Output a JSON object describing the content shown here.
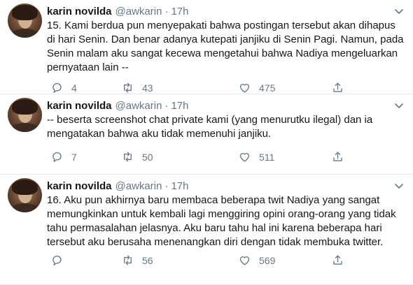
{
  "tweets": [
    {
      "name": "karin novilda",
      "handle": "@awkarin",
      "dot": "·",
      "time": "17h",
      "lines": [
        "15. Kami berdua pun menyepakati bahwa postingan tersebut akan dihapus",
        "di hari Senin. Dan benar adanya kutepati janjiku di Senin Pagi. Namun, pada",
        "Senin malam aku sangat kecewa mengetahui bahwa Nadiya mengeluarkan",
        "pernyataan lain --"
      ],
      "replies": "4",
      "retweets": "43",
      "likes": "475"
    },
    {
      "name": "karin novilda",
      "handle": "@awkarin",
      "dot": "·",
      "time": "17h",
      "lines": [
        "-- beserta screenshot chat private kami (yang menurutku ilegal) dan ia",
        "mengatakan bahwa aku tidak memenuhi janjiku."
      ],
      "replies": "7",
      "retweets": "50",
      "likes": "511"
    },
    {
      "name": "karin novilda",
      "handle": "@awkarin",
      "dot": "·",
      "time": "17h",
      "lines": [
        "16. Aku pun akhirnya baru membaca beberapa twit Nadiya yang sangat",
        "memungkinkan untuk kembali lagi menggiring opini orang-orang yang tidak",
        "tahu permasalahan jelasnya. Aku baru tahu hal ini karena beberapa hari",
        "tersebut aku berusaha menenangkan diri dengan tidak membuka twitter."
      ],
      "replies": "",
      "retweets": "56",
      "likes": "569"
    }
  ]
}
